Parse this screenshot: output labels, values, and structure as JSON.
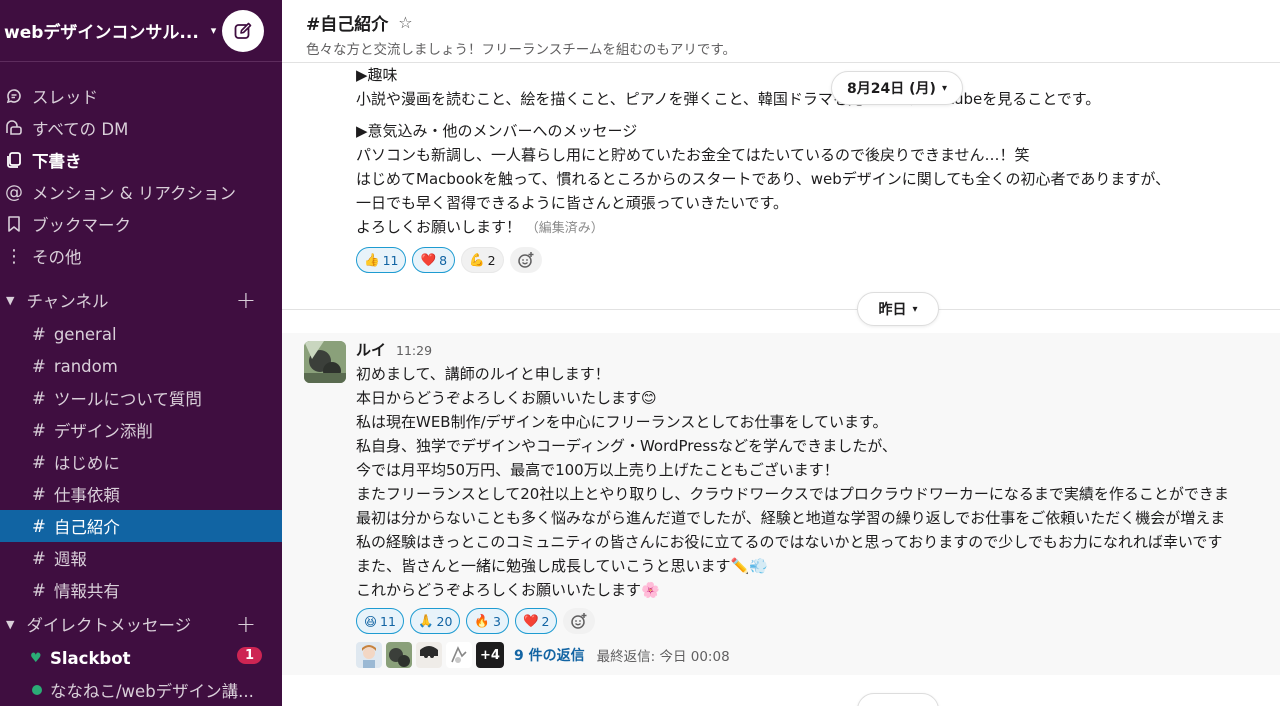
{
  "workspace": {
    "name": "webデザインコンサル...",
    "compose_icon": "compose-icon"
  },
  "nav": [
    {
      "label": "スレッド",
      "icon": "threads-icon"
    },
    {
      "label": "すべての DM",
      "icon": "dm-icon"
    },
    {
      "label": "下書き",
      "icon": "drafts-icon"
    },
    {
      "label": "メンション & リアクション",
      "icon": "mention-icon"
    },
    {
      "label": "ブックマーク",
      "icon": "bookmark-icon"
    },
    {
      "label": "その他",
      "icon": "more-icon"
    }
  ],
  "channels_section": {
    "label": "チャンネル"
  },
  "channels": [
    {
      "name": "general"
    },
    {
      "name": "random"
    },
    {
      "name": "ツールについて質問"
    },
    {
      "name": "デザイン添削"
    },
    {
      "name": "はじめに"
    },
    {
      "name": "仕事依頼"
    },
    {
      "name": "自己紹介"
    },
    {
      "name": "週報"
    },
    {
      "name": "情報共有"
    }
  ],
  "dm_section": {
    "label": "ダイレクトメッセージ"
  },
  "dms": [
    {
      "name": "Slackbot",
      "badge": "1"
    },
    {
      "name": "ななねこ/webデザイン講..."
    }
  ],
  "channel_header": {
    "title": "#自己紹介",
    "topic": "色々な方と交流しましょう！フリーランスチームを組むのもアリです。"
  },
  "date_pills": {
    "first": "8月24日 (月)",
    "second": "昨日"
  },
  "message1": {
    "lines": [
      "▶趣味",
      "小説や漫画を読むこと、絵を描くこと、ピアノを弾くこと、韓国ドラマを見ること、Youtubeを見ることです。",
      "▶意気込み・他のメンバーへのメッセージ",
      "パソコンも新調し、一人暮らし用にと貯めていたお金全てはたいているので後戻りできません…！笑",
      "はじめてMacbookを触って、慣れるところからのスタートであり、webデザインに関しても全くの初心者でありますが、",
      "一日でも早く習得できるように皆さんと頑張っていきたいです。",
      "よろしくお願いします！"
    ],
    "edited": "（編集済み）",
    "reactions": [
      {
        "emoji": "👍",
        "count": "11",
        "mine": true
      },
      {
        "emoji": "❤️",
        "count": "8",
        "mine": true
      },
      {
        "emoji": "💪",
        "count": "2",
        "mine": false
      }
    ]
  },
  "message2": {
    "author": "ルイ",
    "time": "11:29",
    "lines": [
      "初めまして、講師のルイと申します！",
      "本日からどうぞよろしくお願いいたします😊",
      "私は現在WEB制作/デザインを中心にフリーランスとしてお仕事をしています。",
      "私自身、独学でデザインやコーディング・WordPressなどを学んできましたが、",
      "今では月平均50万円、最高で100万以上売り上げたこともございます！",
      "またフリーランスとして20社以上とやり取りし、クラウドワークスではプロクラウドワーカーになるまで実績を作ることができま",
      "最初は分からないことも多く悩みながら進んだ道でしたが、経験と地道な学習の繰り返しでお仕事をご依頼いただく機会が増えま",
      "私の経験はきっとこのコミュニティの皆さんにお役に立てるのではないかと思っておりますので少しでもお力になれれば幸いです",
      "また、皆さんと一緒に勉強し成長していこうと思います✏️💨",
      "これからどうぞよろしくお願いいたします🌸"
    ],
    "reactions": [
      {
        "emoji": "😆",
        "count": "11",
        "mine": true
      },
      {
        "emoji": "🙏",
        "count": "20",
        "mine": true
      },
      {
        "emoji": "🔥",
        "count": "3",
        "mine": true
      },
      {
        "emoji": "❤️",
        "count": "2",
        "mine": true
      }
    ],
    "thread": {
      "more": "+4",
      "replies": "9 件の返信",
      "last": "最終返信: 今日 00:08"
    }
  },
  "colors": {
    "sidebar": "#3f0e40",
    "active": "#1164a3",
    "badge": "#cd2553",
    "link": "#1264a3"
  }
}
